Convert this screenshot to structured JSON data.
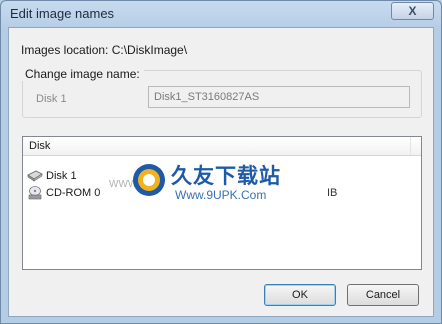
{
  "window": {
    "title": "Edit image names",
    "close_label": "X"
  },
  "location": {
    "label": "Images location: C:\\DiskImage\\"
  },
  "change_group": {
    "legend": "Change image name:",
    "disk_label": "Disk 1",
    "name_value": "Disk1_ST3160827AS"
  },
  "list": {
    "header": "Disk",
    "rows": [
      {
        "label": "Disk 1",
        "icon": "hard-disk-icon",
        "size": ""
      },
      {
        "label": "CD-ROM 0",
        "icon": "cdrom-icon",
        "size": "IB"
      }
    ]
  },
  "watermark": {
    "title": "久友下载站",
    "url": "Www.9UPK.Com",
    "small": "WWW. 9U"
  },
  "buttons": {
    "ok": "OK",
    "cancel": "Cancel"
  },
  "colors": {
    "title_accent": "#1e5aa8",
    "default_button_border": "#3c7fb1"
  }
}
